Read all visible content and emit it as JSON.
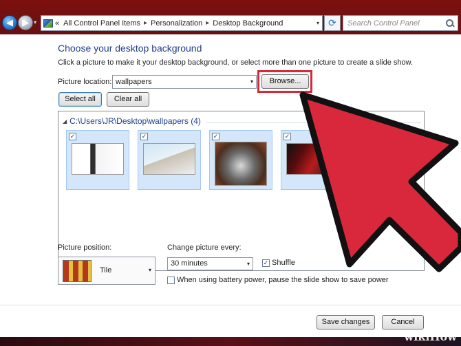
{
  "address_bar": {
    "root_glyph": "«",
    "crumbs": [
      "All Control Panel Items",
      "Personalization",
      "Desktop Background"
    ]
  },
  "search": {
    "placeholder": "Search Control Panel"
  },
  "page": {
    "heading": "Choose your desktop background",
    "subtext": "Click a picture to make it your desktop background, or select more than one picture to create a slide show."
  },
  "picture_location": {
    "label": "Picture location:",
    "value": "wallpapers",
    "browse_label": "Browse..."
  },
  "selection": {
    "select_all_label": "Select all",
    "clear_all_label": "Clear all"
  },
  "gallery": {
    "folder_title": "C:\\Users\\JR\\Desktop\\wallpapers (4)",
    "thumbnails": [
      {
        "checked": true
      },
      {
        "checked": true
      },
      {
        "checked": true
      },
      {
        "checked": true
      }
    ]
  },
  "picture_position": {
    "label": "Picture position:",
    "value": "Tile"
  },
  "change_every": {
    "label": "Change picture every:",
    "value": "30 minutes"
  },
  "shuffle": {
    "label": "Shuffle",
    "checked": true
  },
  "battery": {
    "label": "When using battery power, pause the slide show to save power",
    "checked": false
  },
  "footer": {
    "save_label": "Save changes",
    "cancel_label": "Cancel"
  },
  "watermark": "wikiHow",
  "colors": {
    "highlight": "#d9283c",
    "arrow": "#d9283c",
    "heading": "#1e3c8c"
  },
  "glyphs": {
    "checkmark": "✓",
    "dropdown": "▾",
    "refresh": "⟳",
    "back": "◀",
    "forward": "▶"
  }
}
